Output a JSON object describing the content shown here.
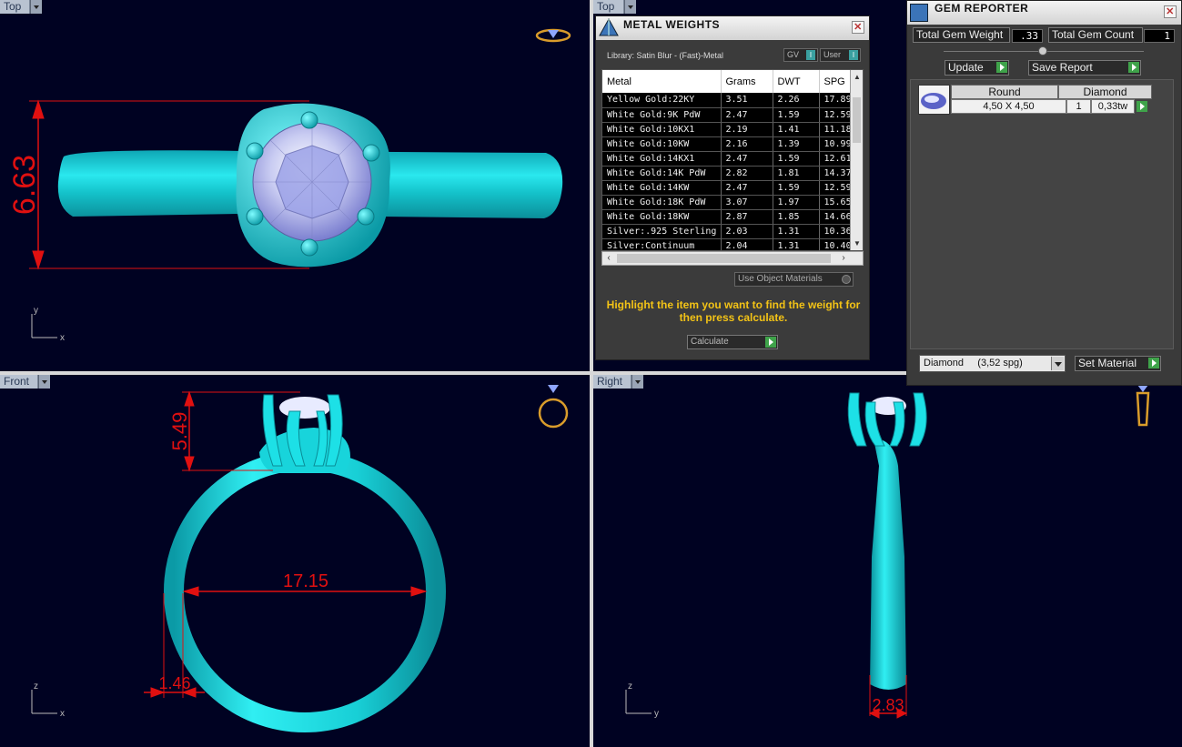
{
  "viewports": {
    "top_left": {
      "label": "Top",
      "dimension": "6.63",
      "axis_v": "y",
      "axis_h": "x"
    },
    "top_right": {
      "label": "Top"
    },
    "front": {
      "label": "Front",
      "dim_height": "5.49",
      "dim_inner": "17.15",
      "dim_band": "1.46",
      "axis_v": "z",
      "axis_h": "x"
    },
    "right": {
      "label": "Right",
      "dim_width": "2.83",
      "axis_v": "z",
      "axis_h": "y"
    }
  },
  "metal_weights": {
    "title": "METAL WEIGHTS",
    "close": "✕",
    "library": "Library: Satin Blur - (Fast)-Metal",
    "gv_label": "GV",
    "user_label": "User",
    "indicator": "I",
    "columns": [
      "Metal",
      "Grams",
      "DWT",
      "SPG"
    ],
    "rows": [
      [
        "Yellow Gold:22KY",
        "3.51",
        "2.26",
        "17.89"
      ],
      [
        "White Gold:9K PdW",
        "2.47",
        "1.59",
        "12.59"
      ],
      [
        "White Gold:10KX1",
        "2.19",
        "1.41",
        "11.18"
      ],
      [
        "White Gold:10KW",
        "2.16",
        "1.39",
        "10.99"
      ],
      [
        "White Gold:14KX1",
        "2.47",
        "1.59",
        "12.61"
      ],
      [
        "White Gold:14K PdW",
        "2.82",
        "1.81",
        "14.37"
      ],
      [
        "White Gold:14KW",
        "2.47",
        "1.59",
        "12.59"
      ],
      [
        "White Gold:18K PdW",
        "3.07",
        "1.97",
        "15.65"
      ],
      [
        "White Gold:18KW",
        "2.87",
        "1.85",
        "14.66"
      ],
      [
        "Silver:.925 Sterling",
        "2.03",
        "1.31",
        "10.36"
      ],
      [
        "Silver:Continuum",
        "2.04",
        "1.31",
        "10.40"
      ]
    ],
    "use_object_materials": "Use Object Materials",
    "hint": "Highlight the item you want to find the weight for then press calculate.",
    "calculate": "Calculate"
  },
  "gem_reporter": {
    "title": "GEM REPORTER",
    "close": "✕",
    "total_weight_label": "Total Gem Weight",
    "total_weight_value": ".33",
    "total_count_label": "Total Gem Count",
    "total_count_value": "1",
    "update": "Update",
    "save_report": "Save Report",
    "gem": {
      "shape": "Round",
      "type": "Diamond",
      "size": "4,50 X 4,50",
      "count": "1",
      "weight": "0,33tw"
    },
    "material": "Diamond     (3,52 spg)",
    "set_material": "Set Material"
  },
  "colors": {
    "viewport_bg": "#000222",
    "ring": "#1fd6dd",
    "dimension": "#e01010",
    "hint": "#f3c316",
    "accent_play": "#3fa34a"
  }
}
